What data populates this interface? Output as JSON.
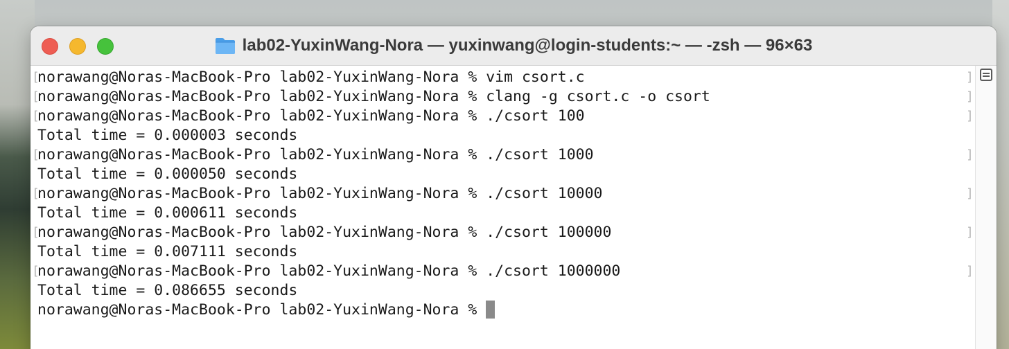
{
  "window": {
    "title": "lab02-YuxinWang-Nora — yuxinwang@login-students:~ — -zsh — 96×63",
    "folder_icon": "folder-icon",
    "colors": {
      "close": "#ee5d53",
      "minimize": "#f5b82e",
      "maximize": "#46c23c"
    }
  },
  "terminal": {
    "lines": [
      {
        "text": "norawang@Noras-MacBook-Pro lab02-YuxinWang-Nora % vim csort.c",
        "marked": true
      },
      {
        "text": "norawang@Noras-MacBook-Pro lab02-YuxinWang-Nora % clang -g csort.c -o csort",
        "marked": true
      },
      {
        "text": "norawang@Noras-MacBook-Pro lab02-YuxinWang-Nora % ./csort 100",
        "marked": true
      },
      {
        "text": "Total time = 0.000003 seconds",
        "marked": false
      },
      {
        "text": "norawang@Noras-MacBook-Pro lab02-YuxinWang-Nora % ./csort 1000",
        "marked": true
      },
      {
        "text": "Total time = 0.000050 seconds",
        "marked": false
      },
      {
        "text": "norawang@Noras-MacBook-Pro lab02-YuxinWang-Nora % ./csort 10000",
        "marked": true
      },
      {
        "text": "Total time = 0.000611 seconds",
        "marked": false
      },
      {
        "text": "norawang@Noras-MacBook-Pro lab02-YuxinWang-Nora % ./csort 100000",
        "marked": true
      },
      {
        "text": "Total time = 0.007111 seconds",
        "marked": false
      },
      {
        "text": "norawang@Noras-MacBook-Pro lab02-YuxinWang-Nora % ./csort 1000000",
        "marked": true
      },
      {
        "text": "Total time = 0.086655 seconds",
        "marked": false
      }
    ],
    "prompt": "norawang@Noras-MacBook-Pro lab02-YuxinWang-Nora % ",
    "mark_left": "[",
    "mark_right": "]"
  }
}
